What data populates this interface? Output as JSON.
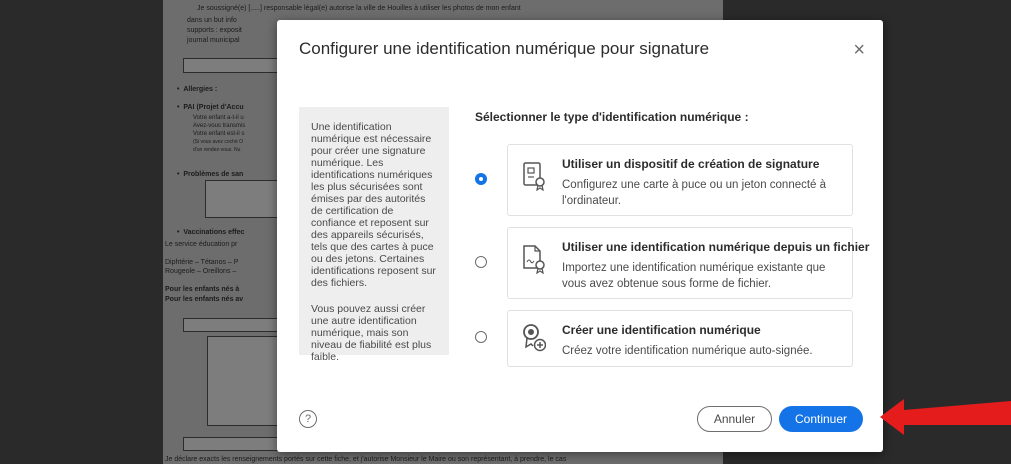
{
  "background_doc": {
    "lines": [
      "Je soussigné(e)  [.....]  responsable légal(e) autorise la ville de Houilles à utiliser les photos de mon enfant",
      "dans un but info",
      "supports : exposit",
      "journal municipal"
    ],
    "sections": [
      "Allergies :",
      "PAI (Projet d'Accu",
      "Problèmes de san",
      "Vaccinations effec"
    ],
    "small_lines": [
      "Votre enfant a-t-il u",
      "Avez-vous transmis",
      "Votre enfant est-il s",
      "(Si vous avez coché O",
      "d'un rendez-vous. Nu"
    ],
    "service_line": "Le service éducation pr",
    "vaccines": [
      "Diphtérie – Tétanos – P",
      "Rougeole – Oreillons –"
    ],
    "children_lines": [
      "Pour les enfants nés à",
      "Pour les enfants nés av"
    ],
    "bottom_line": "Je déclare exacts les renseignements portés sur cette fiche, et j'autorise Monsieur le Maire ou son représentant, à prendre, le cas"
  },
  "dialog": {
    "title": "Configurer une identification numérique pour signature",
    "close_symbol": "×",
    "info_paragraph_1": "Une identification numérique est nécessaire pour créer une signature numérique. Les identifications numériques les plus sécurisées sont émises par des autorités de certification de confiance et reposent sur des appareils sécurisés, tels que des cartes à puce ou des jetons. Certaines identifications reposent sur des fichiers.",
    "info_paragraph_2": "Vous pouvez aussi créer une autre identification numérique, mais son niveau de fiabilité est plus faible.",
    "select_title": "Sélectionner le type d'identification numérique :",
    "options": [
      {
        "title": "Utiliser un dispositif de création de signature",
        "desc": "Configurez une carte à puce ou un jeton connecté à l'ordinateur.",
        "icon": "smart-card-icon",
        "selected": true
      },
      {
        "title": "Utiliser une identification numérique depuis un fichier",
        "desc": "Importez une identification numérique existante que vous avez obtenue sous forme de fichier.",
        "icon": "certificate-file-icon",
        "selected": false
      },
      {
        "title": "Créer une identification numérique",
        "desc": "Créez votre identification numérique auto-signée.",
        "icon": "create-badge-icon",
        "selected": false
      }
    ],
    "help_symbol": "?",
    "cancel_label": "Annuler",
    "continue_label": "Continuer"
  },
  "colors": {
    "accent": "#1473e6",
    "arrow": "#e51c1c",
    "overlay": "#2a2a2a"
  }
}
